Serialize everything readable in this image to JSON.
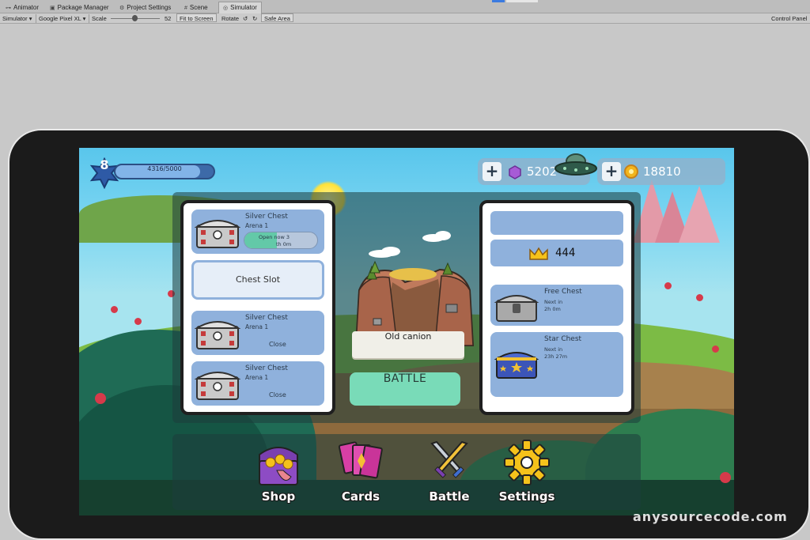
{
  "editor": {
    "tabs": [
      {
        "label": "Animator",
        "icon": "animator-icon"
      },
      {
        "label": "Package Manager",
        "icon": "package-icon"
      },
      {
        "label": "Project Settings",
        "icon": "gear-icon"
      },
      {
        "label": "Scene",
        "icon": "scene-icon"
      },
      {
        "label": "Simulator",
        "icon": "simulator-icon"
      }
    ],
    "toolbar": {
      "mode": "Simulator",
      "device": "Google Pixel XL",
      "scale_label": "Scale",
      "scale_value": "52",
      "fit_to_screen": "Fit to Screen",
      "rotate": "Rotate",
      "safe_area": "Safe Area",
      "control_panel": "Control Panel"
    }
  },
  "game": {
    "level": "8",
    "xp_text": "4316/5000",
    "xp_progress": 0.86,
    "gems": "5202",
    "coins": "18810",
    "left_slots": [
      {
        "name": "Silver Chest",
        "arena": "Arena 1",
        "open_line1": "Open now 3",
        "open_line2": "th 0m",
        "progress": 0.45
      },
      {
        "empty_label": "Chest Slot"
      },
      {
        "name": "Silver Chest",
        "arena": "Arena 1",
        "close": "Close"
      },
      {
        "name": "Silver Chest",
        "arena": "Arena 1",
        "close": "Close"
      }
    ],
    "arena_name": "Old canion",
    "battle_button": "BATTLE",
    "trophies": "444",
    "right_chests": [
      {
        "name": "Free Chest",
        "next_label": "Next in",
        "next_time": "2h 0m"
      },
      {
        "name": "Star Chest",
        "next_label": "Next in",
        "next_time": "23h 27m"
      }
    ],
    "nav": [
      {
        "label": "Shop",
        "icon": "shop-icon"
      },
      {
        "label": "Cards",
        "icon": "cards-icon"
      },
      {
        "label": "Battle",
        "icon": "swords-icon"
      },
      {
        "label": "Settings",
        "icon": "gear-icon"
      }
    ]
  },
  "watermark": "anysourcecode.com",
  "colors": {
    "panel_blue": "#8fb1dc",
    "battle_green": "#79dbb8",
    "sky": "#59c6ec"
  }
}
